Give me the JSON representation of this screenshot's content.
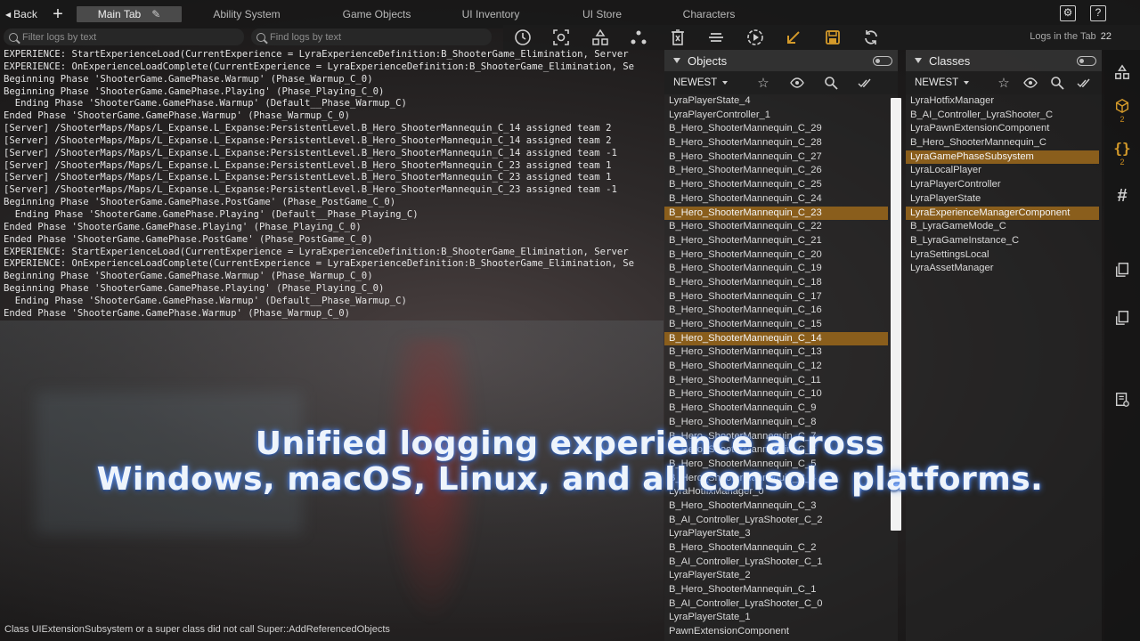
{
  "topbar": {
    "back_label": "Back",
    "tabs": [
      {
        "label": "Main Tab",
        "active": true
      },
      {
        "label": "Ability System",
        "active": false
      },
      {
        "label": "Game Objects",
        "active": false
      },
      {
        "label": "UI Inventory",
        "active": false
      },
      {
        "label": "UI Store",
        "active": false
      },
      {
        "label": "Characters",
        "active": false
      }
    ]
  },
  "filters": {
    "filter_placeholder": "Filter logs by text",
    "find_placeholder": "Find logs by text"
  },
  "toolbar": {
    "logs_label": "Logs in the Tab",
    "logs_count": "22",
    "icons": [
      "clock-icon",
      "focus-icon",
      "hierarchy-icon",
      "nodes-icon",
      "clear-icon",
      "lines-icon",
      "play-icon",
      "arrow-down-left-icon",
      "save-icon",
      "refresh-icon"
    ],
    "accent": "#d49a2a"
  },
  "logs": [
    "EXPERIENCE: StartExperienceLoad(CurrentExperience = LyraExperienceDefinition:B_ShooterGame_Elimination, Server",
    "EXPERIENCE: OnExperienceLoadComplete(CurrentExperience = LyraExperienceDefinition:B_ShooterGame_Elimination, Se",
    "Beginning Phase 'ShooterGame.GamePhase.Warmup' (Phase_Warmup_C_0)",
    "Beginning Phase 'ShooterGame.GamePhase.Playing' (Phase_Playing_C_0)",
    "  Ending Phase 'ShooterGame.GamePhase.Warmup' (Default__Phase_Warmup_C)",
    "Ended Phase 'ShooterGame.GamePhase.Warmup' (Phase_Warmup_C_0)",
    "[Server] /ShooterMaps/Maps/L_Expanse.L_Expanse:PersistentLevel.B_Hero_ShooterMannequin_C_14 assigned team 2",
    "[Server] /ShooterMaps/Maps/L_Expanse.L_Expanse:PersistentLevel.B_Hero_ShooterMannequin_C_14 assigned team 2",
    "[Server] /ShooterMaps/Maps/L_Expanse.L_Expanse:PersistentLevel.B_Hero_ShooterMannequin_C_14 assigned team -1",
    "[Server] /ShooterMaps/Maps/L_Expanse.L_Expanse:PersistentLevel.B_Hero_ShooterMannequin_C_23 assigned team 1",
    "[Server] /ShooterMaps/Maps/L_Expanse.L_Expanse:PersistentLevel.B_Hero_ShooterMannequin_C_23 assigned team 1",
    "[Server] /ShooterMaps/Maps/L_Expanse.L_Expanse:PersistentLevel.B_Hero_ShooterMannequin_C_23 assigned team -1",
    "Beginning Phase 'ShooterGame.GamePhase.PostGame' (Phase_PostGame_C_0)",
    "  Ending Phase 'ShooterGame.GamePhase.Playing' (Default__Phase_Playing_C)",
    "Ended Phase 'ShooterGame.GamePhase.Playing' (Phase_Playing_C_0)",
    "Ended Phase 'ShooterGame.GamePhase.PostGame' (Phase_PostGame_C_0)",
    "EXPERIENCE: StartExperienceLoad(CurrentExperience = LyraExperienceDefinition:B_ShooterGame_Elimination, Server",
    "EXPERIENCE: OnExperienceLoadComplete(CurrentExperience = LyraExperienceDefinition:B_ShooterGame_Elimination, Se",
    "Beginning Phase 'ShooterGame.GamePhase.Warmup' (Phase_Warmup_C_0)",
    "Beginning Phase 'ShooterGame.GamePhase.Playing' (Phase_Playing_C_0)",
    "  Ending Phase 'ShooterGame.GamePhase.Warmup' (Default__Phase_Warmup_C)",
    "Ended Phase 'ShooterGame.GamePhase.Warmup' (Phase_Warmup_C_0)"
  ],
  "status_line": "Class UIExtensionSubsystem or a super class did not call Super::AddReferencedObjects",
  "objects": {
    "title": "Objects",
    "sort_label": "NEWEST",
    "items": [
      {
        "label": "LyraPlayerState_4",
        "hl": false
      },
      {
        "label": "LyraPlayerController_1",
        "hl": false
      },
      {
        "label": "B_Hero_ShooterMannequin_C_29",
        "hl": false
      },
      {
        "label": "B_Hero_ShooterMannequin_C_28",
        "hl": false
      },
      {
        "label": "B_Hero_ShooterMannequin_C_27",
        "hl": false
      },
      {
        "label": "B_Hero_ShooterMannequin_C_26",
        "hl": false
      },
      {
        "label": "B_Hero_ShooterMannequin_C_25",
        "hl": false
      },
      {
        "label": "B_Hero_ShooterMannequin_C_24",
        "hl": false
      },
      {
        "label": "B_Hero_ShooterMannequin_C_23",
        "hl": true
      },
      {
        "label": "B_Hero_ShooterMannequin_C_22",
        "hl": false
      },
      {
        "label": "B_Hero_ShooterMannequin_C_21",
        "hl": false
      },
      {
        "label": "B_Hero_ShooterMannequin_C_20",
        "hl": false
      },
      {
        "label": "B_Hero_ShooterMannequin_C_19",
        "hl": false
      },
      {
        "label": "B_Hero_ShooterMannequin_C_18",
        "hl": false
      },
      {
        "label": "B_Hero_ShooterMannequin_C_17",
        "hl": false
      },
      {
        "label": "B_Hero_ShooterMannequin_C_16",
        "hl": false
      },
      {
        "label": "B_Hero_ShooterMannequin_C_15",
        "hl": false
      },
      {
        "label": "B_Hero_ShooterMannequin_C_14",
        "hl": true
      },
      {
        "label": "B_Hero_ShooterMannequin_C_13",
        "hl": false
      },
      {
        "label": "B_Hero_ShooterMannequin_C_12",
        "hl": false
      },
      {
        "label": "B_Hero_ShooterMannequin_C_11",
        "hl": false
      },
      {
        "label": "B_Hero_ShooterMannequin_C_10",
        "hl": false
      },
      {
        "label": "B_Hero_ShooterMannequin_C_9",
        "hl": false
      },
      {
        "label": "B_Hero_ShooterMannequin_C_8",
        "hl": false
      },
      {
        "label": "B_Hero_ShooterMannequin_C_7",
        "hl": false
      },
      {
        "label": "B_Hero_ShooterMannequin_C_6",
        "hl": false
      },
      {
        "label": "B_Hero_ShooterMannequin_C_5",
        "hl": false
      },
      {
        "label": "B_Hero_ShooterMannequin_C_4",
        "hl": false
      },
      {
        "label": "LyraHotfixManager_0",
        "hl": false
      },
      {
        "label": "B_Hero_ShooterMannequin_C_3",
        "hl": false
      },
      {
        "label": "B_AI_Controller_LyraShooter_C_2",
        "hl": false
      },
      {
        "label": "LyraPlayerState_3",
        "hl": false
      },
      {
        "label": "B_Hero_ShooterMannequin_C_2",
        "hl": false
      },
      {
        "label": "B_AI_Controller_LyraShooter_C_1",
        "hl": false
      },
      {
        "label": "LyraPlayerState_2",
        "hl": false
      },
      {
        "label": "B_Hero_ShooterMannequin_C_1",
        "hl": false
      },
      {
        "label": "B_AI_Controller_LyraShooter_C_0",
        "hl": false
      },
      {
        "label": "LyraPlayerState_1",
        "hl": false
      },
      {
        "label": "PawnExtensionComponent",
        "hl": false
      }
    ]
  },
  "classes": {
    "title": "Classes",
    "sort_label": "NEWEST",
    "items": [
      {
        "label": "LyraHotfixManager",
        "hl": false
      },
      {
        "label": "B_AI_Controller_LyraShooter_C",
        "hl": false
      },
      {
        "label": "LyraPawnExtensionComponent",
        "hl": false
      },
      {
        "label": "B_Hero_ShooterMannequin_C",
        "hl": false
      },
      {
        "label": "LyraGamePhaseSubsystem",
        "hl": true
      },
      {
        "label": "LyraLocalPlayer",
        "hl": false
      },
      {
        "label": "LyraPlayerController",
        "hl": false
      },
      {
        "label": "LyraPlayerState",
        "hl": false
      },
      {
        "label": "LyraExperienceManagerComponent",
        "hl": true
      },
      {
        "label": "B_LyraGameMode_C",
        "hl": false
      },
      {
        "label": "B_LyraGameInstance_C",
        "hl": false
      },
      {
        "label": "LyraSettingsLocal",
        "hl": false
      },
      {
        "label": "LyraAssetManager",
        "hl": false
      }
    ]
  },
  "rail": {
    "objects_count": "2",
    "classes_count": "2"
  },
  "caption": {
    "line1": "Unified logging experience across",
    "line2": "Windows, macOS, Linux, and all console platforms."
  }
}
